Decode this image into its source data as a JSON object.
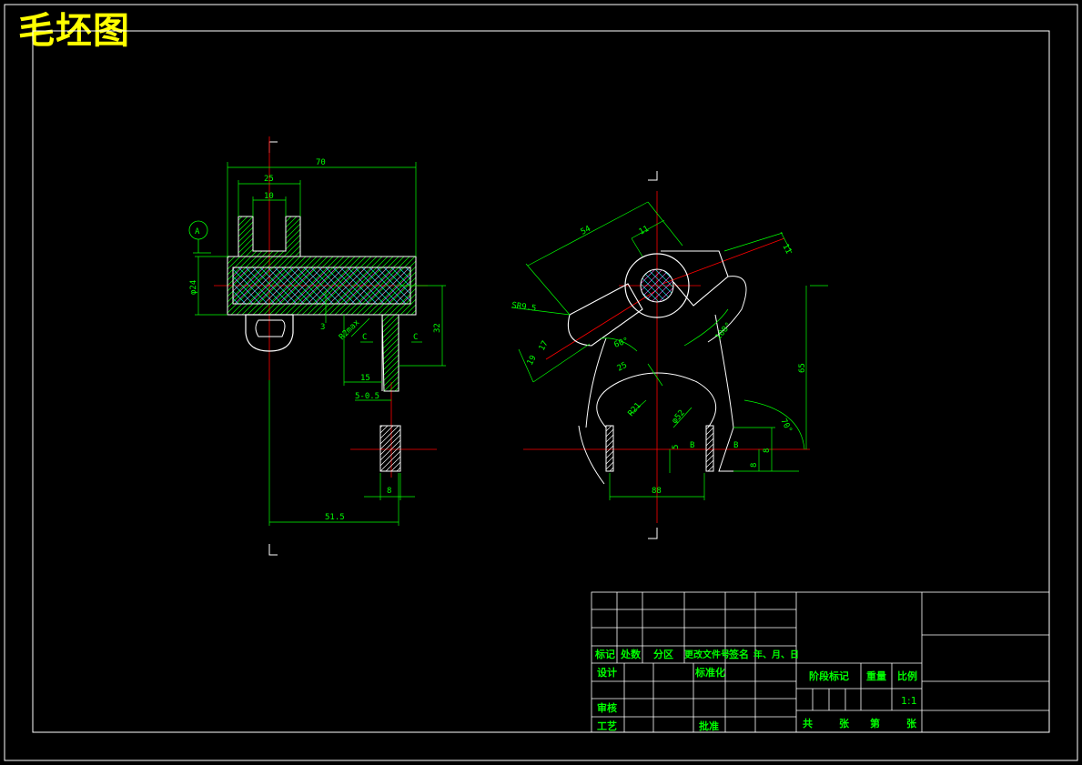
{
  "drawing": {
    "title": "毛坯图",
    "datum_label": "A",
    "section_label": "C",
    "section_label_b": "B",
    "colors": {
      "frame": "#ffffff",
      "dimension": "#00ff00",
      "centerline": "#ff0000",
      "hatch": "#ff00ff",
      "title": "#ffff00",
      "object": "#ffffff"
    }
  },
  "left_view": {
    "dims": {
      "overall_length": "70",
      "top_width": "25",
      "slot_width": "10",
      "diameter": "φ24",
      "height_right": "32",
      "rad": "R2max",
      "small": "3",
      "dim_15": "15",
      "dim_5": "5-0.5",
      "dim_8": "8",
      "dim_515": "51.5"
    }
  },
  "right_view": {
    "dims": {
      "d54": "54",
      "d11": "11",
      "d11b": "11",
      "sr": "SR9.5",
      "d17": "17",
      "d19": "19",
      "ang60": "60°",
      "d25": "25",
      "ang108": "108°",
      "d65": "65",
      "r21": "R21",
      "phi52": "φ52",
      "d5": "5",
      "b1": "B",
      "b2": "B",
      "d8a": "8",
      "d8b": "8",
      "ang70": "70°",
      "d88": "88"
    }
  },
  "title_block": {
    "rev_headers": [
      "标记",
      "处数",
      "分区",
      "更改文件号",
      "签名",
      "年、月、日"
    ],
    "design": "设计",
    "standard": "标准化",
    "review": "审核",
    "process": "工艺",
    "approve": "批准",
    "stage_mark": "阶段标记",
    "weight": "重量",
    "scale_label": "比例",
    "scale_value": "1:1",
    "total": "共",
    "sheets": "张",
    "no": "第",
    "sheet": "张"
  }
}
